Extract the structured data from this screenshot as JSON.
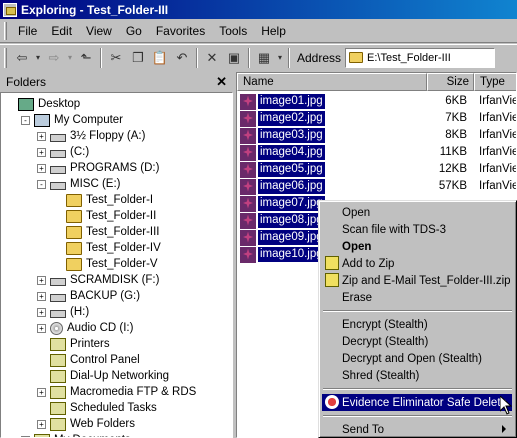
{
  "window": {
    "title": "Exploring - Test_Folder-III"
  },
  "menu": [
    "File",
    "Edit",
    "View",
    "Go",
    "Favorites",
    "Tools",
    "Help"
  ],
  "toolbar": {
    "address_label": "Address",
    "address_value": "E:\\Test_Folder-III"
  },
  "folders_panel": {
    "title": "Folders",
    "tree": [
      {
        "label": "Desktop",
        "icon": "desktop-icon",
        "level": 0,
        "expander": ""
      },
      {
        "label": "My Computer",
        "icon": "computer-icon",
        "level": 1,
        "expander": "-"
      },
      {
        "label": "3½ Floppy (A:)",
        "icon": "floppy-icon",
        "level": 2,
        "expander": "+"
      },
      {
        "label": "(C:)",
        "icon": "drive-icon",
        "level": 2,
        "expander": "+"
      },
      {
        "label": "PROGRAMS (D:)",
        "icon": "drive-icon",
        "level": 2,
        "expander": "+"
      },
      {
        "label": "MISC (E:)",
        "icon": "drive-icon",
        "level": 2,
        "expander": "-"
      },
      {
        "label": "Test_Folder-I",
        "icon": "folder-icon",
        "level": 3,
        "expander": ""
      },
      {
        "label": "Test_Folder-II",
        "icon": "folder-icon",
        "level": 3,
        "expander": ""
      },
      {
        "label": "Test_Folder-III",
        "icon": "folder-open-icon",
        "level": 3,
        "expander": ""
      },
      {
        "label": "Test_Folder-IV",
        "icon": "folder-icon",
        "level": 3,
        "expander": ""
      },
      {
        "label": "Test_Folder-V",
        "icon": "folder-icon",
        "level": 3,
        "expander": ""
      },
      {
        "label": "SCRAMDISK (F:)",
        "icon": "drive-icon",
        "level": 2,
        "expander": "+"
      },
      {
        "label": "BACKUP (G:)",
        "icon": "drive-icon",
        "level": 2,
        "expander": "+"
      },
      {
        "label": "(H:)",
        "icon": "network-drive-icon",
        "level": 2,
        "expander": "+"
      },
      {
        "label": "Audio CD (I:)",
        "icon": "cd-icon",
        "level": 2,
        "expander": "+"
      },
      {
        "label": "Printers",
        "icon": "printers-icon",
        "level": 2,
        "expander": ""
      },
      {
        "label": "Control Panel",
        "icon": "control-panel-icon",
        "level": 2,
        "expander": ""
      },
      {
        "label": "Dial-Up Networking",
        "icon": "dialup-icon",
        "level": 2,
        "expander": ""
      },
      {
        "label": "Macromedia FTP & RDS",
        "icon": "ftp-icon",
        "level": 2,
        "expander": "+"
      },
      {
        "label": "Scheduled Tasks",
        "icon": "tasks-icon",
        "level": 2,
        "expander": ""
      },
      {
        "label": "Web Folders",
        "icon": "web-folders-icon",
        "level": 2,
        "expander": "+"
      },
      {
        "label": "My Documents",
        "icon": "documents-icon",
        "level": 1,
        "expander": "+"
      }
    ]
  },
  "files_panel": {
    "columns": [
      "Name",
      "Size",
      "Type"
    ],
    "files": [
      {
        "name": "image01.jpg",
        "size": "6KB",
        "type": "IrfanView"
      },
      {
        "name": "image02.jpg",
        "size": "7KB",
        "type": "IrfanView"
      },
      {
        "name": "image03.jpg",
        "size": "8KB",
        "type": "IrfanView"
      },
      {
        "name": "image04.jpg",
        "size": "11KB",
        "type": "IrfanView"
      },
      {
        "name": "image05.jpg",
        "size": "12KB",
        "type": "IrfanView"
      },
      {
        "name": "image06.jpg",
        "size": "57KB",
        "type": "IrfanView"
      },
      {
        "name": "image07.jpg",
        "size": "",
        "type": ""
      },
      {
        "name": "image08.jpg",
        "size": "",
        "type": ""
      },
      {
        "name": "image09.jpg",
        "size": "",
        "type": ""
      },
      {
        "name": "image10.jpg",
        "size": "",
        "type": ""
      }
    ]
  },
  "context_menu": {
    "items": [
      {
        "label": "Open",
        "bold": false,
        "icon": ""
      },
      {
        "label": "Scan file with TDS-3",
        "bold": false,
        "icon": ""
      },
      {
        "label": "Open",
        "bold": true,
        "icon": ""
      },
      {
        "label": "Add to Zip",
        "bold": false,
        "icon": "zip-icon"
      },
      {
        "label": "Zip and E-Mail Test_Folder-III.zip",
        "bold": false,
        "icon": "zip-icon"
      },
      {
        "label": "Erase",
        "bold": false,
        "icon": ""
      },
      {
        "separator": true
      },
      {
        "label": "Encrypt (Stealth)",
        "bold": false,
        "icon": ""
      },
      {
        "label": "Decrypt (Stealth)",
        "bold": false,
        "icon": ""
      },
      {
        "label": "Decrypt and Open (Stealth)",
        "bold": false,
        "icon": ""
      },
      {
        "label": "Shred (Stealth)",
        "bold": false,
        "icon": ""
      },
      {
        "separator": true
      },
      {
        "label": "Evidence Eliminator Safe Delete",
        "bold": false,
        "icon": "evidence-eliminator-icon",
        "highlighted": true
      },
      {
        "separator": true
      },
      {
        "label": "Send To",
        "bold": false,
        "icon": "",
        "submenu": true
      }
    ]
  },
  "colors": {
    "selection": "#000080",
    "face": "#c0c0c0",
    "title_start": "#000080",
    "title_end": "#1084d0"
  }
}
